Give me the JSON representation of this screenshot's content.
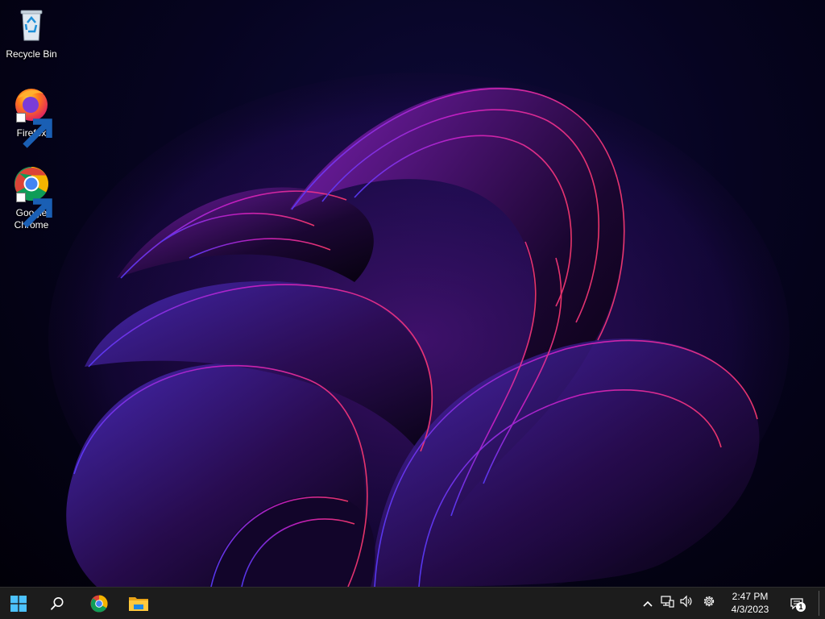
{
  "desktop": {
    "icons": [
      {
        "label": "Recycle Bin",
        "icon": "recycle-bin-icon",
        "shortcut": false
      },
      {
        "label": "Firefox",
        "icon": "firefox-icon",
        "shortcut": true
      },
      {
        "label": "Google Chrome",
        "icon": "chrome-icon",
        "shortcut": true
      }
    ]
  },
  "taskbar": {
    "pinned": [
      {
        "icon": "windows-start-icon"
      },
      {
        "icon": "search-icon"
      },
      {
        "icon": "chrome-icon"
      },
      {
        "icon": "file-explorer-icon"
      }
    ],
    "tray": {
      "icons": [
        "chevron-up-icon",
        "network-icon",
        "volume-icon",
        "settings-gear-icon"
      ],
      "time": "2:47 PM",
      "date": "4/3/2023",
      "notification_count": "1"
    }
  },
  "colors": {
    "taskbar_bg": "#1c1c1c",
    "windows_blue": "#4cc2ff",
    "wallpaper_magenta": "#c020d0",
    "wallpaper_blue": "#3a2aa8"
  }
}
